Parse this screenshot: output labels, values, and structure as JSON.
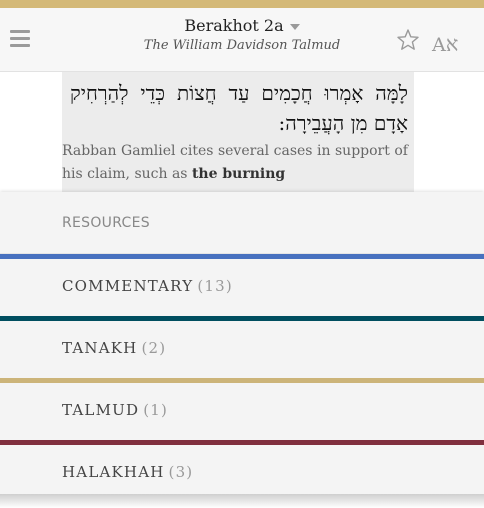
{
  "header": {
    "title": "Berakhot 2a",
    "subtitle": "The William Davidson Talmud",
    "lang_toggle": "AA",
    "icons": [
      "menu-icon",
      "caret-down-icon",
      "star-icon",
      "language-toggle-icon"
    ]
  },
  "text": {
    "hebrew": "לָמָּה אָמְרוּ חֲכָמִים עַד חֲצוֹת כְּדֵי לְהַרְחִיק אָדָם מִן הָעֲבֵירָה:",
    "english_before": "Rabban Gamliel cites several cases in support of his claim, such as",
    "english_bold": "the burning"
  },
  "resources": {
    "header": "RESOURCES",
    "categories": [
      {
        "label": "COMMENTARY",
        "count": "(13)",
        "color": "#4871bf"
      },
      {
        "label": "TANAKH",
        "count": "(2)",
        "color": "#004e5f"
      },
      {
        "label": "TALMUD",
        "count": "(1)",
        "color": "#ccb479"
      },
      {
        "label": "HALAKHAH",
        "count": "(3)",
        "color": "#802f3e"
      }
    ]
  },
  "colors": {
    "top_strip": "#d4b978",
    "panel_bg": "#ececec",
    "sheet_bg": "#f4f4f4"
  }
}
